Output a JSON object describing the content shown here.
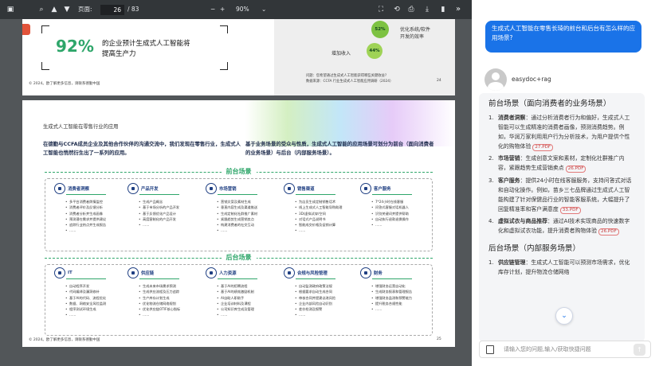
{
  "toolbar": {
    "page_label": "页面:",
    "page_value": "26",
    "page_total": "/ 83",
    "zoom_minus": "−",
    "zoom_plus": "+",
    "zoom_value": "90%",
    "zoom_caret": "⌄",
    "more": "»"
  },
  "page1": {
    "stat": "92%",
    "desc_line1": "的企业预计生成式人工智能将",
    "desc_line2": "提高生产力",
    "chart_label_a": "优化系统/软件",
    "chart_label_b": "开发的效率",
    "chart_label_c": "增加收入",
    "pct_a": "52%",
    "pct_b": "44%",
    "source_q": "问题：您希望通过生成式人工智能获得哪些关键收益?",
    "source": "数据来源：CCFA 行业生成式人工智能应用调研（2024）",
    "footer": "© 2024。欧了解更多信息，请联系德勤中国",
    "page_no": "24"
  },
  "page2": {
    "title": "生成式人工智能在零售行业的应用",
    "intro_left": "在德勤与CCFA成员企业及其他合作伙伴的沟通交流中，我们发现在零售行业，生成式人工智能也悄然衍生出了一系列的应用。",
    "intro_right": "基于业务场景的受众与性质，生成式人工智能的应用场景可划分为前台（面向消费者的业务场景）与后台（内部服务场景）。",
    "front_title": "前台场景",
    "back_title": "后台场景",
    "front_cols": [
      {
        "title": "消费者洞察",
        "items": [
          "多平台消费者舆情监控",
          "消费者评价及反馈分析",
          "消费者分析并生成画像",
          "预测潜在需求并提供建议",
          "追踪行业热点并生成报告",
          "……"
        ]
      },
      {
        "title": "产品开发",
        "items": [
          "生成产品概念",
          "基于市场分析的产品开发",
          "基于反馈优化产品设计",
          "高度客制化的产品开发",
          "……"
        ]
      },
      {
        "title": "市场营销",
        "items": [
          "营销文案及素材生成",
          "垂直内容生成及渠道推送",
          "生成定制化社群推广素材",
          "紧跟趋势生成营销卖点",
          "构建消费者的社交互动",
          "……"
        ]
      },
      {
        "title": "销售渠道",
        "items": [
          "为店员生成定制销售话术",
          "线上生成式人工智能导购助理",
          "3D/虚拟试穿/空间",
          "对话式产品说明书",
          "智能成交价格及促销计算",
          "……"
        ]
      },
      {
        "title": "客户服务",
        "items": [
          "7*24小时在线客服",
          "问答式客服对话机器人",
          "识别关键词并提供帮助",
          "自动执行退款退换操作",
          "……"
        ]
      }
    ],
    "back_cols": [
      {
        "title": "IT",
        "items": [
          "自动程序开发",
          "代码编译及漏洞修补",
          "基于AI的代码、流程优化",
          "数据、网络安全风险监测",
          "程序测试环境生成",
          "……"
        ]
      },
      {
        "title": "供应链",
        "items": [
          "生成未来市场需求预测",
          "生成供应流程及压力追踪",
          "生产库存计划生成",
          "优化物流仓储网络规划",
          "优化供应链OTIF核心指标",
          "……"
        ]
      },
      {
        "title": "人力资源",
        "items": [
          "基于AI的招聘流程",
          "基于AI的绩效激励机制",
          "AI自助人职助手",
          "企业培训材料及课程",
          "公司知识库生成及管理",
          "……"
        ]
      },
      {
        "title": "合规与风险管理",
        "items": [
          "自动监测政府政策法规",
          "根据要求自动生成合同",
          "审核合同并提建议改风险",
          "企业内部风险自动识别",
          "差价检测及报警",
          "……"
        ]
      },
      {
        "title": "财务",
        "items": [
          "增强财务运营自动化",
          "生成财务报表和管理报告",
          "增强财务监测和预警能力",
          "提升税务合规性能",
          "……"
        ]
      }
    ],
    "footer": "© 2024。欧了解更多信息，请联系德勤中国",
    "page_no": "25"
  },
  "chat": {
    "question": "生成式人工智能在零售长琦的前台和后台有怎么样的应用场景?",
    "user_name": "easydoc+rag",
    "section1": "前台场景（面向消费者的业务场景）",
    "items": [
      {
        "num": "1.",
        "title": "消费者洞察",
        "text": "：通过分析消费者行为和偏好，生成式人工智能可以生成精准的消费者画像，预测消费趋势。例如，华润万家利用用户行为分析技术，为用户提供个性化的购物体验",
        "ref": "27.PDF"
      },
      {
        "num": "2.",
        "title": "市场营销",
        "text": "：生成创意文案和素材，定制化社群推广内容，紧跟趋势生成营销卖点",
        "ref": "26.PDF"
      },
      {
        "num": "3.",
        "title": "客户服务",
        "text": "：提供24小时在线客服服务，支持问答式对话和自动化操作。例如，苗乡三七品牌通过生成式人工智能构建了针对保健品行业的智能客服系统，大幅提升了回复精准率和客户满意度",
        "ref": "33.PDF"
      },
      {
        "num": "4.",
        "title": "虚拟试衣与商品推荐",
        "text": "：通过AI技术实现商品的快速数字化和虚拟试衣功能，提升消费者购物体验",
        "ref": "26.PDF"
      }
    ],
    "section2": "后台场景（内部服务场景）",
    "item5_num": "1.",
    "item5_title": "供应链管理",
    "item5_text": "：生成式人工智能可以预测市场需求，优化库存计划，提升物流仓储网络",
    "input_placeholder": "请输入您的问题,输入/获取快捷问题"
  },
  "colors": {
    "accent": "#1a73e8",
    "green": "#2ea66a",
    "navy": "#1f3f82",
    "toolbar": "#323639"
  }
}
